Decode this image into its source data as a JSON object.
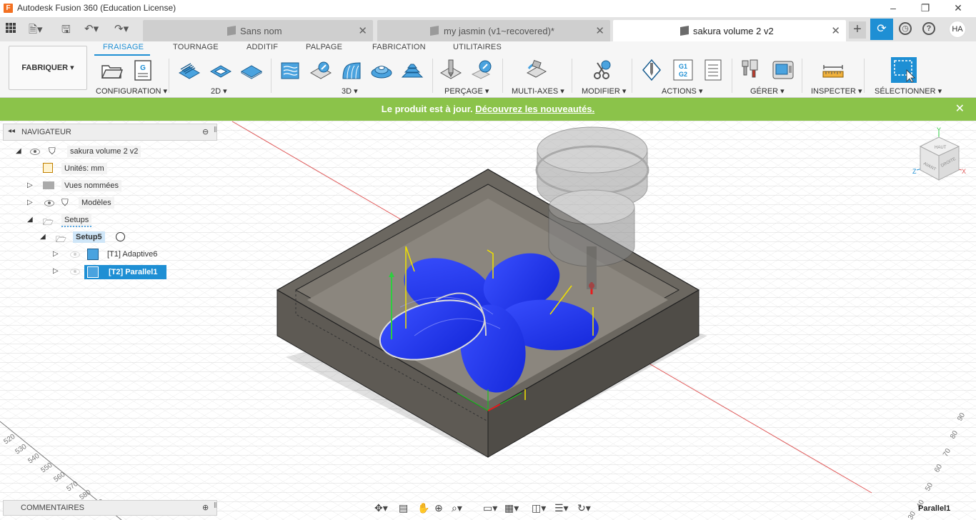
{
  "window": {
    "app_icon_letter": "F",
    "title": "Autodesk Fusion 360 (Education License)"
  },
  "tabs": [
    {
      "label": "Sans nom"
    },
    {
      "label": "my jasmin (v1~recovered)*"
    },
    {
      "label": "sakura volume 2 v2"
    }
  ],
  "user": {
    "initials": "HA"
  },
  "ribbon": {
    "workspace": "FABRIQUER",
    "tabs": [
      "FRAISAGE",
      "TOURNAGE",
      "ADDITIF",
      "PALPAGE",
      "FABRICATION",
      "UTILITAIRES"
    ],
    "groups": [
      "CONFIGURATION",
      "2D",
      "3D",
      "PERÇAGE",
      "MULTI-AXES",
      "MODIFIER",
      "ACTIONS",
      "GÉRER",
      "INSPECTER",
      "SÉLECTIONNER"
    ]
  },
  "banner": {
    "text": "Le produit est à jour.",
    "link": "Découvrez les nouveautés."
  },
  "navigator": {
    "title": "NAVIGATEUR",
    "root": "sakura volume 2 v2",
    "units": "Unités: mm",
    "named_views": "Vues nommées",
    "models": "Modèles",
    "setups": "Setups",
    "setup": "Setup5",
    "op1": "[T1] Adaptive6",
    "op2": "[T2] Parallel1"
  },
  "viewcube": {
    "face_top": "HAUT",
    "face_front": "AVANT",
    "face_right": "DROITE",
    "axis_x": "X",
    "axis_y": "Y",
    "axis_z": "Z"
  },
  "grid_labels_left": [
    "520",
    "530",
    "540",
    "550",
    "560",
    "570",
    "580",
    "590"
  ],
  "grid_labels_right": [
    "90",
    "80",
    "70",
    "60",
    "50",
    "40",
    "30"
  ],
  "comments": {
    "title": "COMMENTAIRES"
  },
  "status": {
    "active_operation": "Parallel1"
  },
  "colors": {
    "accent": "#1e8fd4",
    "banner": "#8bc34a",
    "toolpath": "#1f2fff"
  }
}
